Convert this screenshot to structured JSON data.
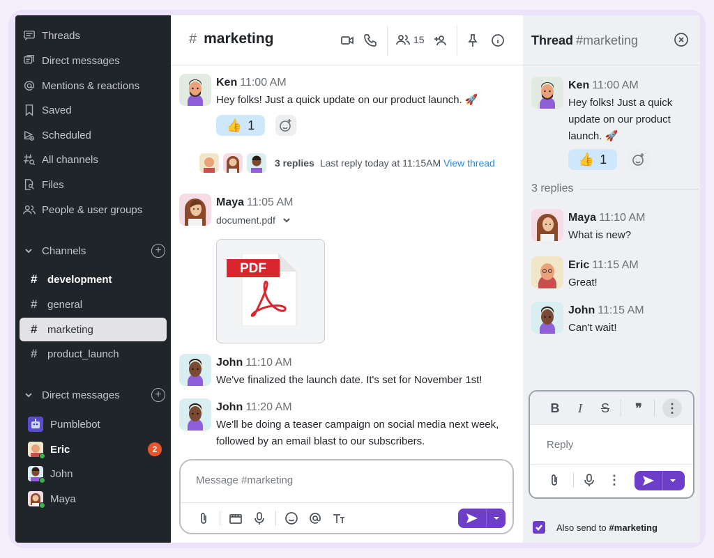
{
  "sidebar": {
    "nav": [
      {
        "label": "Threads",
        "icon": "threads-icon"
      },
      {
        "label": "Direct messages",
        "icon": "direct-messages-icon"
      },
      {
        "label": "Mentions & reactions",
        "icon": "at-icon"
      },
      {
        "label": "Saved",
        "icon": "bookmark-icon"
      },
      {
        "label": "Scheduled",
        "icon": "scheduled-icon"
      },
      {
        "label": "All channels",
        "icon": "channel-search-icon"
      },
      {
        "label": "Files",
        "icon": "file-search-icon"
      },
      {
        "label": "People & user groups",
        "icon": "people-icon"
      }
    ],
    "channels_label": "Channels",
    "channels": [
      "development",
      "general",
      "marketing",
      "product_launch"
    ],
    "dm_label": "Direct messages",
    "dms": [
      {
        "name": "Pumblebot",
        "online": false
      },
      {
        "name": "Eric",
        "online": true,
        "badge": "2"
      },
      {
        "name": "John",
        "online": true
      },
      {
        "name": "Maya",
        "online": true
      }
    ]
  },
  "main": {
    "channel_name": "marketing",
    "member_count": "15",
    "messages": [
      {
        "author": "Ken",
        "time": "11:00 AM",
        "text": "Hey folks! Just a quick update on our product launch. 🚀",
        "reaction": "👍",
        "reaction_count": "1"
      },
      {
        "author": "Maya",
        "time": "11:05 AM",
        "file": "document.pdf",
        "file_label": "PDF"
      },
      {
        "author": "John",
        "time": "11:10 AM",
        "text": "We've finalized the launch date. It's set for November 1st!"
      },
      {
        "author": "John",
        "time": "11:20 AM",
        "text": "We'll be doing a teaser campaign on social media next week, followed by an email blast to our subscribers."
      }
    ],
    "thread_summary": {
      "count": "3 replies",
      "last_reply": "Last reply today at 11:15AM",
      "view": "View thread"
    },
    "composer_placeholder": "Message #marketing"
  },
  "thread": {
    "title": "Thread",
    "channel": "#marketing",
    "parent": {
      "author": "Ken",
      "time": "11:00 AM",
      "text": "Hey folks! Just a quick update on our product launch. 🚀",
      "reaction": "👍",
      "reaction_count": "1"
    },
    "replies_label": "3 replies",
    "replies": [
      {
        "author": "Maya",
        "time": "11:10 AM",
        "text": "What is new?"
      },
      {
        "author": "Eric",
        "time": "11:15 AM",
        "text": "Great!"
      },
      {
        "author": "John",
        "time": "11:15 AM",
        "text": "Can't wait!"
      }
    ],
    "reply_placeholder": "Reply",
    "also_send_label": "Also send to",
    "also_send_channel": "#marketing",
    "also_send_checked": true
  },
  "colors": {
    "sidebar_bg": "#1f2529",
    "accent": "#6f3ec8",
    "link": "#2a87d6",
    "badge": "#e8552a",
    "reaction_bg": "#cfe7fb"
  }
}
